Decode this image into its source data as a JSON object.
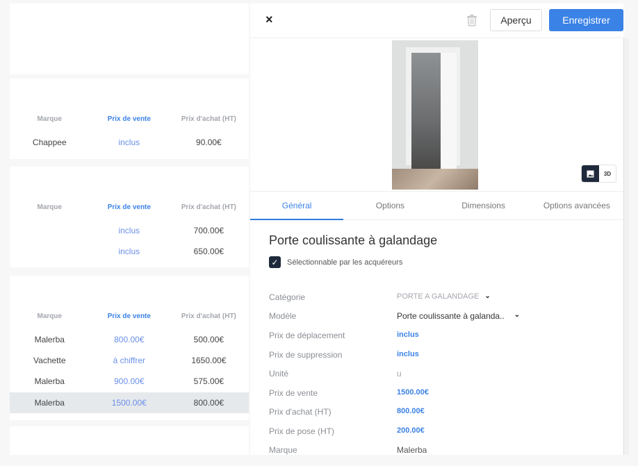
{
  "left_cards": [
    {
      "headers": [
        "Marque",
        "Prix de vente",
        "Prix d'achat (HT)"
      ],
      "rows": [
        [
          "Chappee",
          "inclus",
          "90.00€"
        ]
      ]
    },
    {
      "headers": [
        "Marque",
        "Prix de vente",
        "Prix d'achat (HT)"
      ],
      "rows": [
        [
          "",
          "inclus",
          "700.00€"
        ],
        [
          "",
          "inclus",
          "650.00€"
        ]
      ]
    },
    {
      "headers": [
        "Marque",
        "Prix de vente",
        "Prix d'achat (HT)"
      ],
      "rows": [
        [
          "Malerba",
          "800.00€",
          "500.00€"
        ],
        [
          "Vachette",
          "à chiffrer",
          "1650.00€"
        ],
        [
          "Malerba",
          "900.00€",
          "575.00€"
        ],
        [
          "Malerba",
          "1500.00€",
          "800.00€"
        ]
      ]
    }
  ],
  "panel": {
    "close": "×",
    "preview": "Aperçu",
    "save": "Enregistrer",
    "view_3d": "3D",
    "tabs": [
      "Général",
      "Options",
      "Dimensions",
      "Options avancées"
    ],
    "title": "Porte coulissante à galandage",
    "checkbox_label": "Sélectionnable par les acquéreurs",
    "fields": [
      {
        "label": "Catégorie",
        "value": "PORTE A GALANDAGE"
      },
      {
        "label": "Modèle",
        "value": "Porte coulissante à galanda.."
      },
      {
        "label": "Prix de déplacement",
        "value": "inclus"
      },
      {
        "label": "Prix de suppression",
        "value": "inclus"
      },
      {
        "label": "Unité",
        "value": "u"
      },
      {
        "label": "Prix de vente",
        "value": "1500.00€"
      },
      {
        "label": "Prix d'achat (HT)",
        "value": "800.00€"
      },
      {
        "label": "Prix de pose (HT)",
        "value": "200.00€"
      },
      {
        "label": "Marque",
        "value": "Malerba"
      }
    ]
  },
  "colors": {
    "accent": "#3b82e6",
    "dark": "#1e2a3b"
  }
}
